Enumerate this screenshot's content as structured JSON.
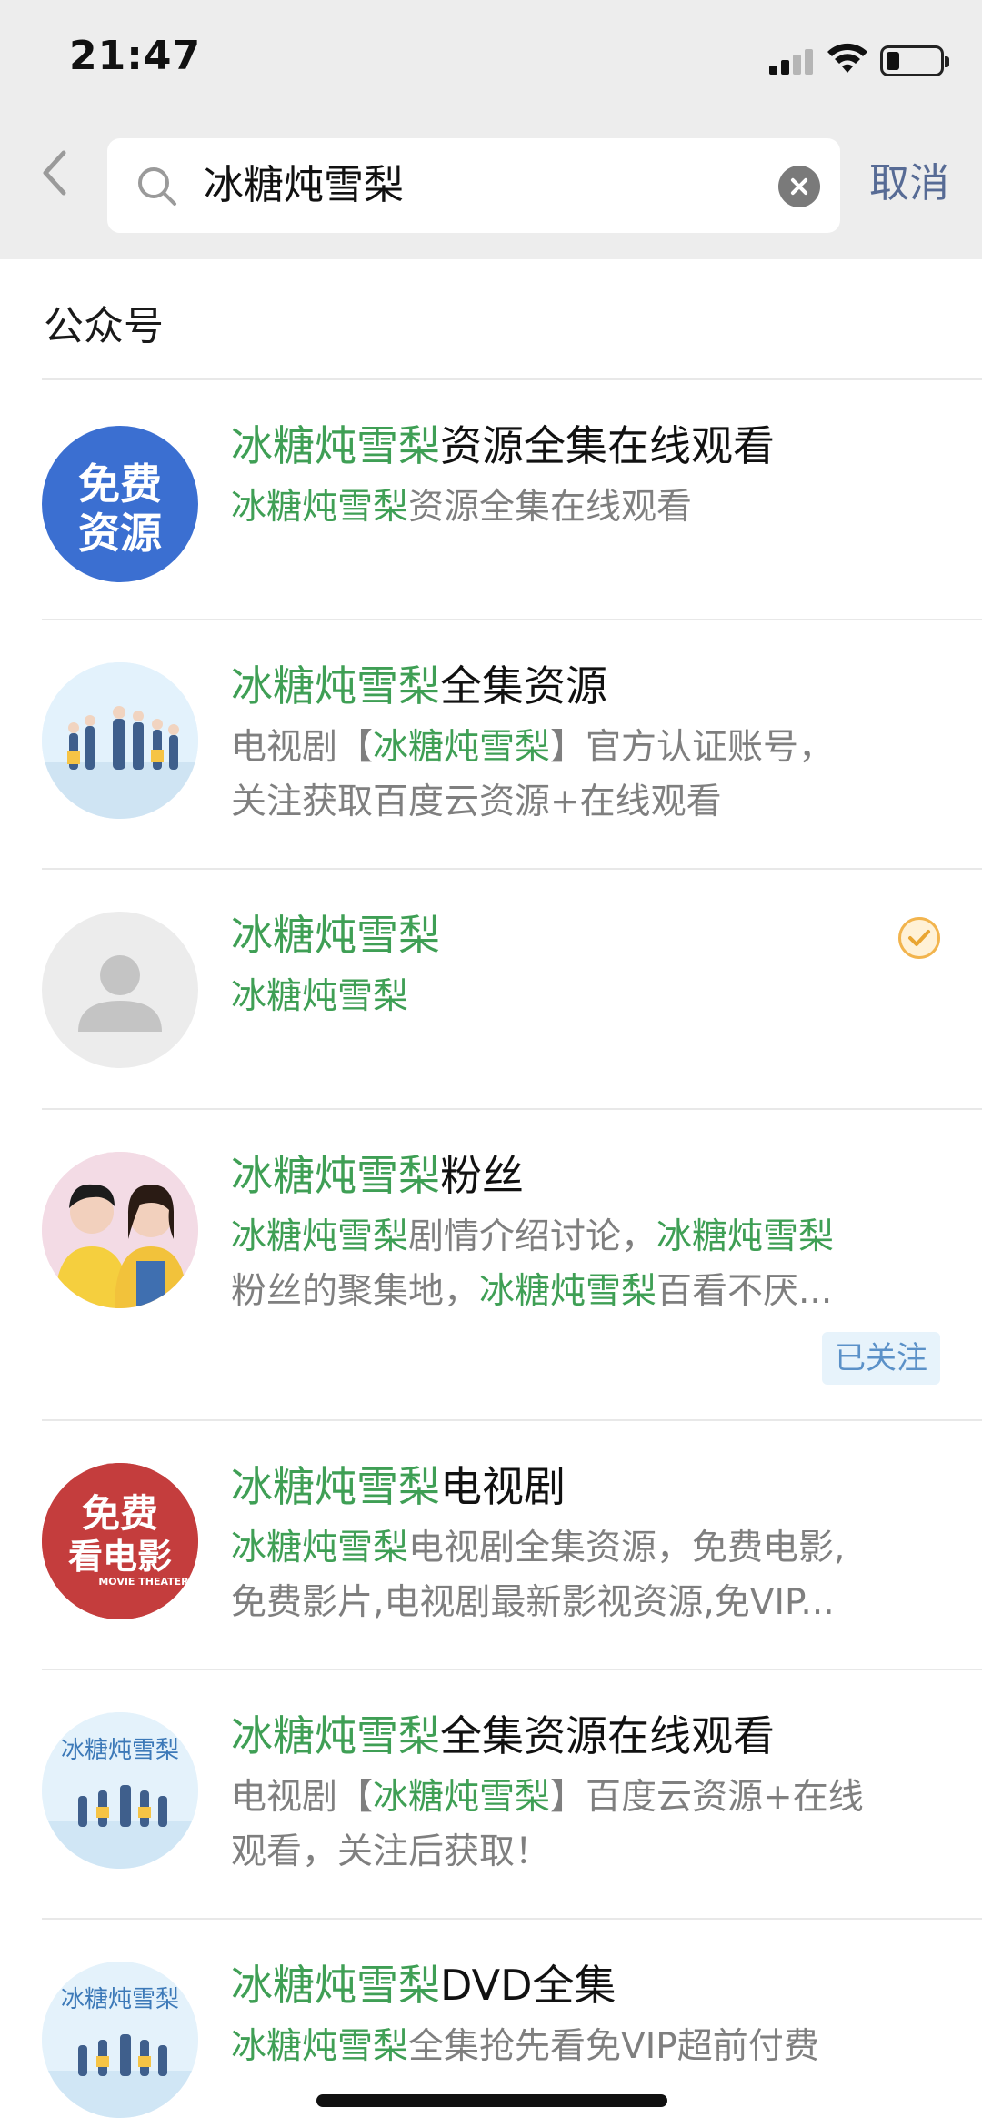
{
  "status_bar": {
    "time": "21:47"
  },
  "search": {
    "query": "冰糖炖雪梨",
    "cancel_label": "取消"
  },
  "section": {
    "title": "公众号"
  },
  "results": [
    {
      "title_hl": "冰糖炖雪梨",
      "title_rest": "资源全集在线观看",
      "line1_hl": "冰糖炖雪梨",
      "line1_rest": "资源全集在线观看",
      "avatar_text_1": "免费",
      "avatar_text_2": "资源"
    },
    {
      "title_hl": "冰糖炖雪梨",
      "title_rest": "全集资源",
      "line1_a": "电视剧【",
      "line1_hl": "冰糖炖雪梨",
      "line1_b": "】官方认证账号，",
      "line2": "关注获取百度云资源+在线观看"
    },
    {
      "title_hl": "冰糖炖雪梨",
      "line1_hl": "冰糖炖雪梨"
    },
    {
      "title_hl": "冰糖炖雪梨",
      "title_rest": "粉丝",
      "line1_hl": "冰糖炖雪梨",
      "line1_mid": "剧情介绍讨论，",
      "line1_hl2": "冰糖炖雪梨",
      "line2_a": "粉丝的聚集地，",
      "line2_hl": "冰糖炖雪梨",
      "line2_b": "百看不厌...",
      "badge": "已关注"
    },
    {
      "title_hl": "冰糖炖雪梨",
      "title_rest": "电视剧",
      "line1_hl": "冰糖炖雪梨",
      "line1_rest": "电视剧全集资源，免费电影,",
      "line2": "免费影片,电视剧最新影视资源,免VIP...",
      "avatar_text_1": "免费",
      "avatar_text_2": "看电影",
      "avatar_text_3": "MOVIE THEATER"
    },
    {
      "title_hl": "冰糖炖雪梨",
      "title_rest": "全集资源在线观看",
      "line1_a": "电视剧【",
      "line1_hl": "冰糖炖雪梨",
      "line1_b": "】百度云资源+在线",
      "line2": "观看，关注后获取！",
      "avatar_text": "冰糖炖雪梨"
    },
    {
      "title_hl": "冰糖炖雪梨",
      "title_rest": "DVD全集",
      "line1_hl": "冰糖炖雪梨",
      "line1_rest": "全集抢先看免VIP超前付费",
      "avatar_text": "冰糖炖雪梨"
    }
  ],
  "colors": {
    "highlight": "#3f9f55",
    "link": "#576b95",
    "header_bg": "#ededed",
    "secondary_text": "#7f7f7f"
  },
  "icons": [
    "back-chevron-icon",
    "search-icon",
    "clear-icon",
    "verified-icon",
    "signal-icon",
    "wifi-icon",
    "battery-icon"
  ]
}
